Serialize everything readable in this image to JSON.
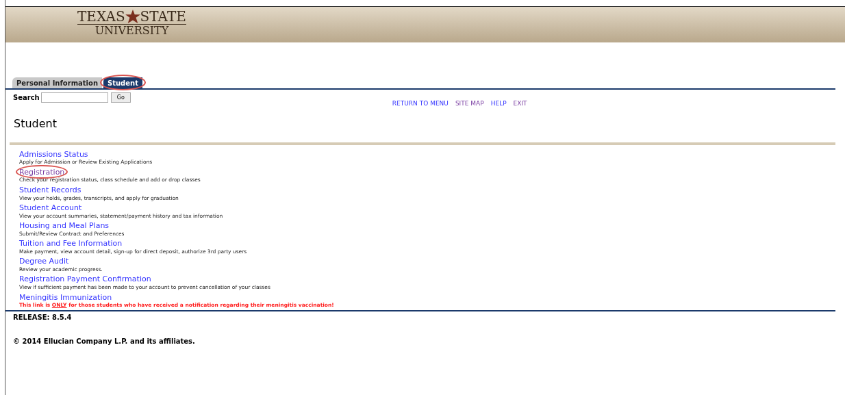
{
  "header": {
    "logo_top_left": "TEXAS",
    "logo_top_right": "STATE",
    "logo_bottom": "UNIVERSITY"
  },
  "tabs": [
    {
      "label": "Personal Information",
      "selected": false,
      "highlighted": false
    },
    {
      "label": "Student",
      "selected": true,
      "highlighted": true
    }
  ],
  "search": {
    "label": "Search",
    "button": "Go"
  },
  "nav_links": [
    {
      "label": "RETURN TO MENU",
      "visited": false
    },
    {
      "label": "SITE MAP",
      "visited": true
    },
    {
      "label": "HELP",
      "visited": false
    },
    {
      "label": "EXIT",
      "visited": true
    }
  ],
  "page_title": "Student",
  "menu_items": [
    {
      "kind": "normal",
      "title": "Admissions Status",
      "description": "Apply for Admission or Review Existing Applications",
      "visited": false,
      "highlighted": false
    },
    {
      "kind": "normal",
      "title": "Registration",
      "description": "Check your registration status, class schedule and add or drop classes",
      "visited": true,
      "highlighted": true
    },
    {
      "kind": "normal",
      "title": "Student Records",
      "description": "View your holds, grades, transcripts, and apply for graduation",
      "visited": false,
      "highlighted": false
    },
    {
      "kind": "normal",
      "title": "Student Account",
      "description": "View your account summaries, statement/payment history and tax information",
      "visited": false,
      "highlighted": false
    },
    {
      "kind": "normal",
      "title": "Housing and Meal Plans",
      "description": "Submit/Review Contract and Preferences",
      "visited": false,
      "highlighted": false
    },
    {
      "kind": "normal",
      "title": "Tuition and Fee Information",
      "description": "Make payment, view account detail, sign-up for direct deposit, authorize 3rd party users",
      "visited": false,
      "highlighted": false
    },
    {
      "kind": "normal",
      "title": "Degree Audit",
      "description": "Review your academic progress.",
      "visited": false,
      "highlighted": false
    },
    {
      "kind": "normal",
      "title": "Registration Payment Confirmation",
      "description": "View if sufficient payment has been made to your account to prevent cancellation of your classes",
      "visited": false,
      "highlighted": false
    },
    {
      "kind": "warning",
      "title": "Meningitis Immunization",
      "warning": {
        "before": "This link is ",
        "emphasis": "ONLY",
        "after": " for those students who have received a notification regarding their meningitis vaccination!"
      },
      "visited": false,
      "highlighted": false
    }
  ],
  "release": "RELEASE: 8.5.4",
  "copyright": "© 2014 Ellucian Company L.P. and its affiliates."
}
